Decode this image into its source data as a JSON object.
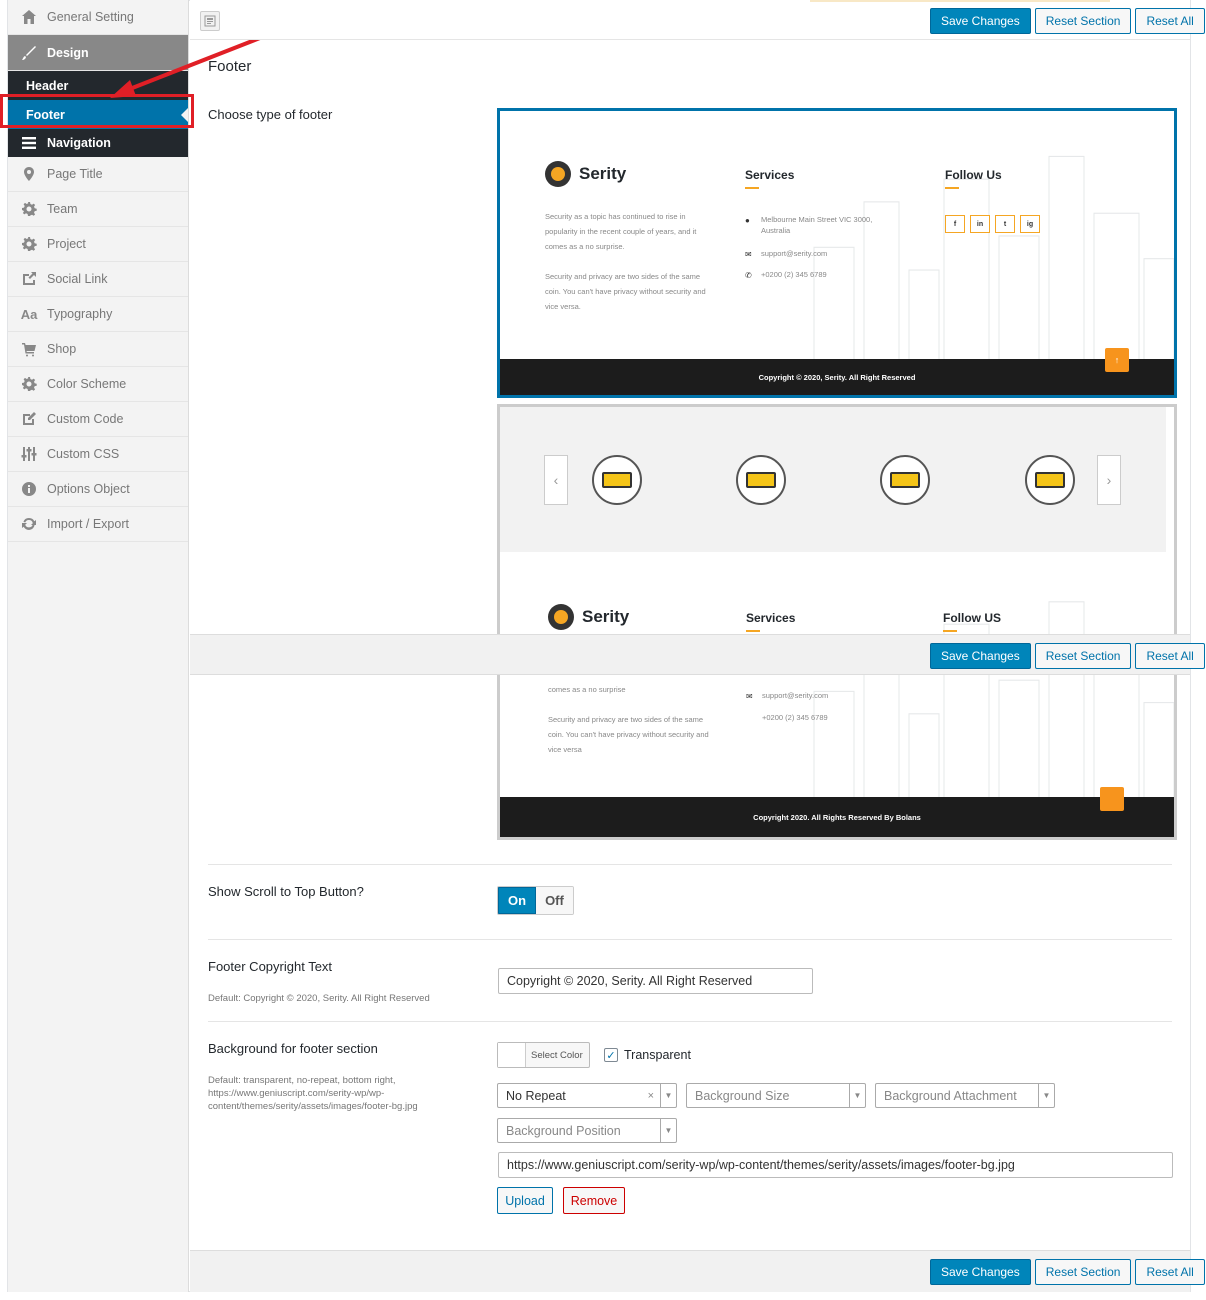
{
  "sidebar": {
    "general": "General Setting",
    "design": "Design",
    "header": "Header",
    "footer": "Footer",
    "navigation": "Navigation",
    "items": [
      {
        "label": "Page Title",
        "icon": "map-pin-icon"
      },
      {
        "label": "Team",
        "icon": "gear-icon"
      },
      {
        "label": "Project",
        "icon": "gear-icon"
      },
      {
        "label": "Social Link",
        "icon": "share-icon"
      },
      {
        "label": "Typography",
        "icon": "typography-icon"
      },
      {
        "label": "Shop",
        "icon": "cart-icon"
      },
      {
        "label": "Color Scheme",
        "icon": "gear-icon"
      },
      {
        "label": "Custom Code",
        "icon": "edit-icon"
      },
      {
        "label": "Custom CSS",
        "icon": "sliders-icon"
      },
      {
        "label": "Options Object",
        "icon": "info-icon"
      },
      {
        "label": "Import / Export",
        "icon": "refresh-icon"
      }
    ]
  },
  "actions": {
    "save": "Save Changes",
    "reset_section": "Reset Section",
    "reset_all": "Reset All"
  },
  "section": {
    "title": "Footer",
    "choose_type_label": "Choose type of footer"
  },
  "preview1": {
    "brand": "Serity",
    "services_heading": "Services",
    "follow_heading": "Follow Us",
    "about_1": "Security as a topic has continued to rise in popularity in the recent couple of years, and it comes as a no surprise.",
    "about_2": "Security and privacy are two sides of the same coin. You can't have privacy without security and vice versa.",
    "address": "Melbourne Main Street VIC 3000, Australia",
    "email": "support@serity.com",
    "phone": "+0200 (2) 345 6789",
    "social": [
      "f",
      "in",
      "t",
      "ig"
    ],
    "copyright": "Copyright © 2020, Serity. All Right Reserved"
  },
  "preview2": {
    "brand": "Serity",
    "services_heading": "Services",
    "follow_heading": "Follow US",
    "about_tail": "comes as a no surprise",
    "about_2": "Security and privacy are two sides of the same coin. You can't have privacy without security and vice versa",
    "email": "support@serity.com",
    "phone": "+0200 (2) 345 6789",
    "copyright": "Copyright 2020. All Rights Reserved By Bolans"
  },
  "scroll_top": {
    "label": "Show Scroll to Top Button?",
    "on": "On",
    "off": "Off"
  },
  "copyright_field": {
    "label": "Footer Copyright Text",
    "default": "Default: Copyright © 2020, Serity. All Right Reserved",
    "value": "Copyright © 2020, Serity. All Right Reserved"
  },
  "background": {
    "label": "Background for footer section",
    "default": "Default: transparent, no-repeat, bottom right, https://www.geniuscript.com/serity-wp/wp-content/themes/serity/assets/images/footer-bg.jpg",
    "select_color": "Select Color",
    "transparent_label": "Transparent",
    "repeat_value": "No Repeat",
    "size_placeholder": "Background Size",
    "attachment_placeholder": "Background Attachment",
    "position_placeholder": "Background Position",
    "url": "https://www.geniuscript.com/serity-wp/wp-content/themes/serity/assets/images/footer-bg.jpg",
    "upload": "Upload",
    "remove": "Remove"
  }
}
